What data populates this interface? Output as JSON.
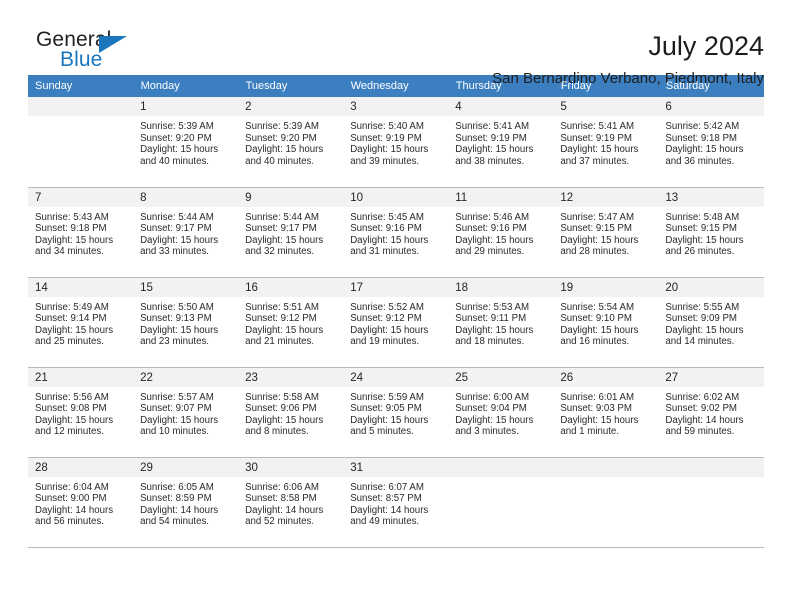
{
  "brand": {
    "word1": "General",
    "word2": "Blue",
    "triangle_color": "#1b76bc"
  },
  "header": {
    "title": "July 2024",
    "subtitle": "San Bernardino Verbano, Piedmont, Italy"
  },
  "theme": {
    "header_blue": "#3c7fc1",
    "daynum_band": "#f2f2f2",
    "row_divider": "#b9b9b9",
    "text": "#2a2a2a"
  },
  "weekday_headers": [
    "Sunday",
    "Monday",
    "Tuesday",
    "Wednesday",
    "Thursday",
    "Friday",
    "Saturday"
  ],
  "weeks": [
    [
      {
        "day": "",
        "sunrise": "",
        "sunset": "",
        "daylight1": "",
        "daylight2": ""
      },
      {
        "day": "1",
        "sunrise": "Sunrise: 5:39 AM",
        "sunset": "Sunset: 9:20 PM",
        "daylight1": "Daylight: 15 hours",
        "daylight2": "and 40 minutes."
      },
      {
        "day": "2",
        "sunrise": "Sunrise: 5:39 AM",
        "sunset": "Sunset: 9:20 PM",
        "daylight1": "Daylight: 15 hours",
        "daylight2": "and 40 minutes."
      },
      {
        "day": "3",
        "sunrise": "Sunrise: 5:40 AM",
        "sunset": "Sunset: 9:19 PM",
        "daylight1": "Daylight: 15 hours",
        "daylight2": "and 39 minutes."
      },
      {
        "day": "4",
        "sunrise": "Sunrise: 5:41 AM",
        "sunset": "Sunset: 9:19 PM",
        "daylight1": "Daylight: 15 hours",
        "daylight2": "and 38 minutes."
      },
      {
        "day": "5",
        "sunrise": "Sunrise: 5:41 AM",
        "sunset": "Sunset: 9:19 PM",
        "daylight1": "Daylight: 15 hours",
        "daylight2": "and 37 minutes."
      },
      {
        "day": "6",
        "sunrise": "Sunrise: 5:42 AM",
        "sunset": "Sunset: 9:18 PM",
        "daylight1": "Daylight: 15 hours",
        "daylight2": "and 36 minutes."
      }
    ],
    [
      {
        "day": "7",
        "sunrise": "Sunrise: 5:43 AM",
        "sunset": "Sunset: 9:18 PM",
        "daylight1": "Daylight: 15 hours",
        "daylight2": "and 34 minutes."
      },
      {
        "day": "8",
        "sunrise": "Sunrise: 5:44 AM",
        "sunset": "Sunset: 9:17 PM",
        "daylight1": "Daylight: 15 hours",
        "daylight2": "and 33 minutes."
      },
      {
        "day": "9",
        "sunrise": "Sunrise: 5:44 AM",
        "sunset": "Sunset: 9:17 PM",
        "daylight1": "Daylight: 15 hours",
        "daylight2": "and 32 minutes."
      },
      {
        "day": "10",
        "sunrise": "Sunrise: 5:45 AM",
        "sunset": "Sunset: 9:16 PM",
        "daylight1": "Daylight: 15 hours",
        "daylight2": "and 31 minutes."
      },
      {
        "day": "11",
        "sunrise": "Sunrise: 5:46 AM",
        "sunset": "Sunset: 9:16 PM",
        "daylight1": "Daylight: 15 hours",
        "daylight2": "and 29 minutes."
      },
      {
        "day": "12",
        "sunrise": "Sunrise: 5:47 AM",
        "sunset": "Sunset: 9:15 PM",
        "daylight1": "Daylight: 15 hours",
        "daylight2": "and 28 minutes."
      },
      {
        "day": "13",
        "sunrise": "Sunrise: 5:48 AM",
        "sunset": "Sunset: 9:15 PM",
        "daylight1": "Daylight: 15 hours",
        "daylight2": "and 26 minutes."
      }
    ],
    [
      {
        "day": "14",
        "sunrise": "Sunrise: 5:49 AM",
        "sunset": "Sunset: 9:14 PM",
        "daylight1": "Daylight: 15 hours",
        "daylight2": "and 25 minutes."
      },
      {
        "day": "15",
        "sunrise": "Sunrise: 5:50 AM",
        "sunset": "Sunset: 9:13 PM",
        "daylight1": "Daylight: 15 hours",
        "daylight2": "and 23 minutes."
      },
      {
        "day": "16",
        "sunrise": "Sunrise: 5:51 AM",
        "sunset": "Sunset: 9:12 PM",
        "daylight1": "Daylight: 15 hours",
        "daylight2": "and 21 minutes."
      },
      {
        "day": "17",
        "sunrise": "Sunrise: 5:52 AM",
        "sunset": "Sunset: 9:12 PM",
        "daylight1": "Daylight: 15 hours",
        "daylight2": "and 19 minutes."
      },
      {
        "day": "18",
        "sunrise": "Sunrise: 5:53 AM",
        "sunset": "Sunset: 9:11 PM",
        "daylight1": "Daylight: 15 hours",
        "daylight2": "and 18 minutes."
      },
      {
        "day": "19",
        "sunrise": "Sunrise: 5:54 AM",
        "sunset": "Sunset: 9:10 PM",
        "daylight1": "Daylight: 15 hours",
        "daylight2": "and 16 minutes."
      },
      {
        "day": "20",
        "sunrise": "Sunrise: 5:55 AM",
        "sunset": "Sunset: 9:09 PM",
        "daylight1": "Daylight: 15 hours",
        "daylight2": "and 14 minutes."
      }
    ],
    [
      {
        "day": "21",
        "sunrise": "Sunrise: 5:56 AM",
        "sunset": "Sunset: 9:08 PM",
        "daylight1": "Daylight: 15 hours",
        "daylight2": "and 12 minutes."
      },
      {
        "day": "22",
        "sunrise": "Sunrise: 5:57 AM",
        "sunset": "Sunset: 9:07 PM",
        "daylight1": "Daylight: 15 hours",
        "daylight2": "and 10 minutes."
      },
      {
        "day": "23",
        "sunrise": "Sunrise: 5:58 AM",
        "sunset": "Sunset: 9:06 PM",
        "daylight1": "Daylight: 15 hours",
        "daylight2": "and 8 minutes."
      },
      {
        "day": "24",
        "sunrise": "Sunrise: 5:59 AM",
        "sunset": "Sunset: 9:05 PM",
        "daylight1": "Daylight: 15 hours",
        "daylight2": "and 5 minutes."
      },
      {
        "day": "25",
        "sunrise": "Sunrise: 6:00 AM",
        "sunset": "Sunset: 9:04 PM",
        "daylight1": "Daylight: 15 hours",
        "daylight2": "and 3 minutes."
      },
      {
        "day": "26",
        "sunrise": "Sunrise: 6:01 AM",
        "sunset": "Sunset: 9:03 PM",
        "daylight1": "Daylight: 15 hours",
        "daylight2": "and 1 minute."
      },
      {
        "day": "27",
        "sunrise": "Sunrise: 6:02 AM",
        "sunset": "Sunset: 9:02 PM",
        "daylight1": "Daylight: 14 hours",
        "daylight2": "and 59 minutes."
      }
    ],
    [
      {
        "day": "28",
        "sunrise": "Sunrise: 6:04 AM",
        "sunset": "Sunset: 9:00 PM",
        "daylight1": "Daylight: 14 hours",
        "daylight2": "and 56 minutes."
      },
      {
        "day": "29",
        "sunrise": "Sunrise: 6:05 AM",
        "sunset": "Sunset: 8:59 PM",
        "daylight1": "Daylight: 14 hours",
        "daylight2": "and 54 minutes."
      },
      {
        "day": "30",
        "sunrise": "Sunrise: 6:06 AM",
        "sunset": "Sunset: 8:58 PM",
        "daylight1": "Daylight: 14 hours",
        "daylight2": "and 52 minutes."
      },
      {
        "day": "31",
        "sunrise": "Sunrise: 6:07 AM",
        "sunset": "Sunset: 8:57 PM",
        "daylight1": "Daylight: 14 hours",
        "daylight2": "and 49 minutes."
      },
      {
        "day": "",
        "sunrise": "",
        "sunset": "",
        "daylight1": "",
        "daylight2": ""
      },
      {
        "day": "",
        "sunrise": "",
        "sunset": "",
        "daylight1": "",
        "daylight2": ""
      },
      {
        "day": "",
        "sunrise": "",
        "sunset": "",
        "daylight1": "",
        "daylight2": ""
      }
    ]
  ]
}
